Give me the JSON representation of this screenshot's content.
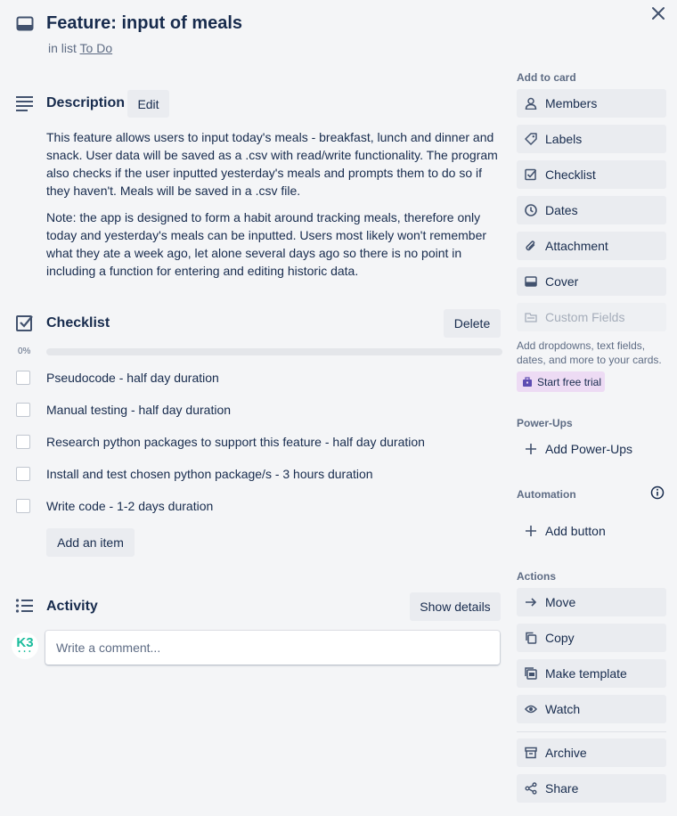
{
  "card": {
    "title": "Feature: input of meals",
    "list_prefix": "in list",
    "list_name": "To Do"
  },
  "description": {
    "heading": "Description",
    "edit_label": "Edit",
    "paragraphs": [
      "This feature allows users to input today's meals - breakfast, lunch and dinner and snack. User data will be saved as a .csv with read/write functionality. The program also checks if the user inputted yesterday's meals and prompts them to do so if they haven't. Meals will be saved in a .csv file.",
      "Note: the app is designed to form a habit around tracking meals, therefore only today and yesterday's meals can be inputted. Users most likely won't remember what they ate a week ago, let alone several days ago so there is no point in including a function for entering and editing historic data."
    ]
  },
  "checklist": {
    "heading": "Checklist",
    "delete_label": "Delete",
    "progress_label": "0%",
    "progress_value": 0,
    "items": [
      {
        "label": "Pseudocode - half day duration",
        "checked": false
      },
      {
        "label": "Manual testing - half day duration",
        "checked": false
      },
      {
        "label": "Research python packages to support this feature - half day duration",
        "checked": false
      },
      {
        "label": "Install and test chosen python package/s - 3 hours duration",
        "checked": false
      },
      {
        "label": "Write code - 1-2 days duration",
        "checked": false
      }
    ],
    "add_item_label": "Add an item"
  },
  "activity": {
    "heading": "Activity",
    "show_details_label": "Show details",
    "comment_placeholder": "Write a comment...",
    "avatar_initials": "K3",
    "avatar_dots": "• • •"
  },
  "sidebar": {
    "add_to_card_heading": "Add to card",
    "add_to_card": [
      {
        "label": "Members",
        "icon": "person-icon"
      },
      {
        "label": "Labels",
        "icon": "tag-icon"
      },
      {
        "label": "Checklist",
        "icon": "checkbox-icon"
      },
      {
        "label": "Dates",
        "icon": "clock-icon"
      },
      {
        "label": "Attachment",
        "icon": "paperclip-icon"
      },
      {
        "label": "Cover",
        "icon": "cover-icon"
      },
      {
        "label": "Custom Fields",
        "icon": "custom-fields-icon",
        "disabled": true
      }
    ],
    "custom_fields_note": "Add dropdowns, text fields, dates, and more to your cards.",
    "trial_label": "Start free trial",
    "powerups_heading": "Power-Ups",
    "add_powerups_label": "Add Power-Ups",
    "automation_heading": "Automation",
    "add_button_label": "Add button",
    "actions_heading": "Actions",
    "actions": [
      {
        "label": "Move",
        "icon": "arrow-right-icon"
      },
      {
        "label": "Copy",
        "icon": "copy-icon"
      },
      {
        "label": "Make template",
        "icon": "template-icon"
      },
      {
        "label": "Watch",
        "icon": "eye-icon"
      },
      {
        "label": "Archive",
        "icon": "archive-icon"
      },
      {
        "label": "Share",
        "icon": "share-icon"
      }
    ]
  },
  "colors": {
    "background": "#f4f5f7",
    "button_gray": "#eaecf0",
    "text": "#172b4d",
    "muted_text": "#5e6c84",
    "trial_purple": "#eddbf4",
    "progress_green": "#5aac44"
  }
}
